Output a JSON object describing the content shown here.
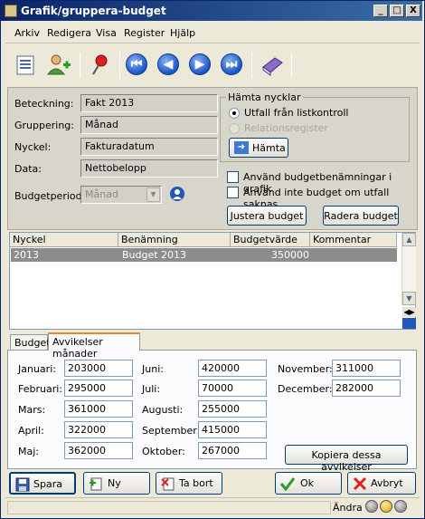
{
  "window": {
    "title": "Grafik/gruppera-budget",
    "minimize": "_",
    "maximize": "□",
    "close": "X"
  },
  "menu": [
    "Arkiv",
    "Redigera",
    "Visa",
    "Register",
    "Hjälp"
  ],
  "form": {
    "beteckning_label": "Beteckning:",
    "beteckning_value": "Fakt 2013",
    "gruppering_label": "Gruppering:",
    "gruppering_value": "Månad",
    "nyckel_label": "Nyckel:",
    "nyckel_value": "Fakturadatum",
    "data_label": "Data:",
    "data_value": "Nettobelopp",
    "budgetperiod_label": "Budgetperiod:",
    "budgetperiod_value": "Månad"
  },
  "hamta": {
    "group_title": "Hämta nycklar",
    "option1": "Utfall från listkontroll",
    "option2": "Relationsregister",
    "button": "Hämta"
  },
  "checkboxes": {
    "use_names": "Använd budgetbenämningar i grafik",
    "skip_budget": "Använd inte budget om utfall saknas"
  },
  "actions": {
    "justera": "Justera budget",
    "radera": "Radera budget"
  },
  "grid": {
    "headers": [
      "Nyckel",
      "Benämning",
      "Budgetvärde",
      "Kommentar"
    ],
    "rows": [
      {
        "nyckel": "2013",
        "benamning": "Budget 2013",
        "budgetvarde": "350000",
        "kommentar": ""
      }
    ]
  },
  "tabs": [
    "Budget",
    "Avvikelser månader"
  ],
  "months": {
    "januari": {
      "label": "Januari:",
      "value": "203000"
    },
    "februari": {
      "label": "Februari:",
      "value": "295000"
    },
    "mars": {
      "label": "Mars:",
      "value": "361000"
    },
    "april": {
      "label": "April:",
      "value": "322000"
    },
    "maj": {
      "label": "Maj:",
      "value": "362000"
    },
    "juni": {
      "label": "Juni:",
      "value": "420000"
    },
    "juli": {
      "label": "Juli:",
      "value": "70000"
    },
    "augusti": {
      "label": "Augusti:",
      "value": "255000"
    },
    "september": {
      "label": "September:",
      "value": "415000"
    },
    "oktober": {
      "label": "Oktober:",
      "value": "267000"
    },
    "november": {
      "label": "November:",
      "value": "311000"
    },
    "december": {
      "label": "December:",
      "value": "282000"
    }
  },
  "kopiera": "Kopiera dessa avvikelser",
  "bottom": {
    "spara": "Spara",
    "ny": "Ny",
    "tabort": "Ta bort",
    "ok": "Ok",
    "avbryt": "Avbryt"
  },
  "status": {
    "mode": "Ändra"
  },
  "colors": {
    "titlebar": "#0a246a",
    "selected_row": "#8c8c8c",
    "tab_accent": "#e68b2c"
  }
}
